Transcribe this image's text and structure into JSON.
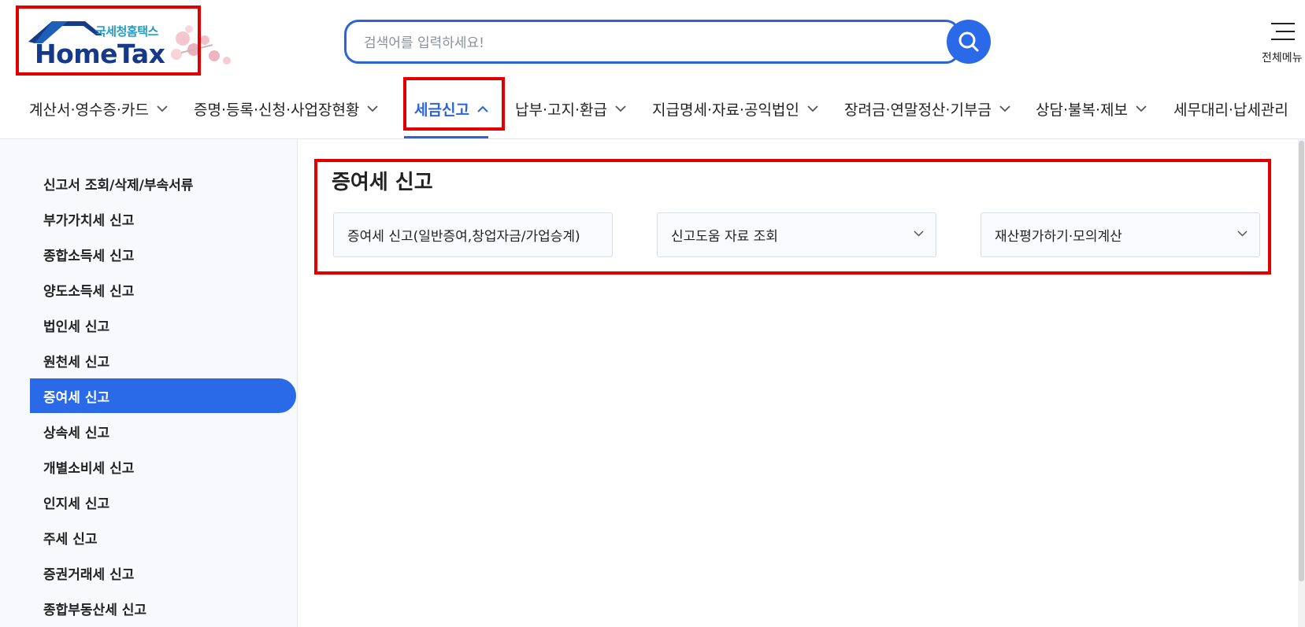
{
  "header": {
    "logo_sub": "국세청홈택스",
    "logo_main": "HomeTax",
    "search_placeholder": "검색어를 입력하세요!",
    "all_menu_label": "전체메뉴"
  },
  "gnb": [
    {
      "label": "계산서·영수증·카드"
    },
    {
      "label": "증명·등록·신청·사업장현황"
    },
    {
      "label": "세금신고",
      "active": true
    },
    {
      "label": "납부·고지·환급"
    },
    {
      "label": "지급명세·자료·공익법인"
    },
    {
      "label": "장려금·연말정산·기부금"
    },
    {
      "label": "상담·불복·제보"
    },
    {
      "label": "세무대리·납세관리"
    }
  ],
  "sidebar": {
    "items": [
      {
        "label": "신고서 조회/삭제/부속서류"
      },
      {
        "label": "부가가치세 신고"
      },
      {
        "label": "종합소득세 신고"
      },
      {
        "label": "양도소득세 신고"
      },
      {
        "label": "법인세 신고"
      },
      {
        "label": "원천세 신고"
      },
      {
        "label": "증여세 신고",
        "active": true
      },
      {
        "label": "상속세 신고"
      },
      {
        "label": "개별소비세 신고"
      },
      {
        "label": "인지세 신고"
      },
      {
        "label": "주세 신고"
      },
      {
        "label": "증권거래세 신고"
      },
      {
        "label": "종합부동산세 신고"
      }
    ]
  },
  "main": {
    "title": "증여세 신고",
    "cards": [
      {
        "label": "증여세 신고(일반증여,창업자금/가업승계)"
      },
      {
        "label": "신고도움 자료 조회"
      },
      {
        "label": "재산평가하기·모의계산"
      }
    ]
  },
  "colors": {
    "accent": "#2a6ae8",
    "highlight": "#e00000",
    "logo_text": "#163a8a"
  }
}
